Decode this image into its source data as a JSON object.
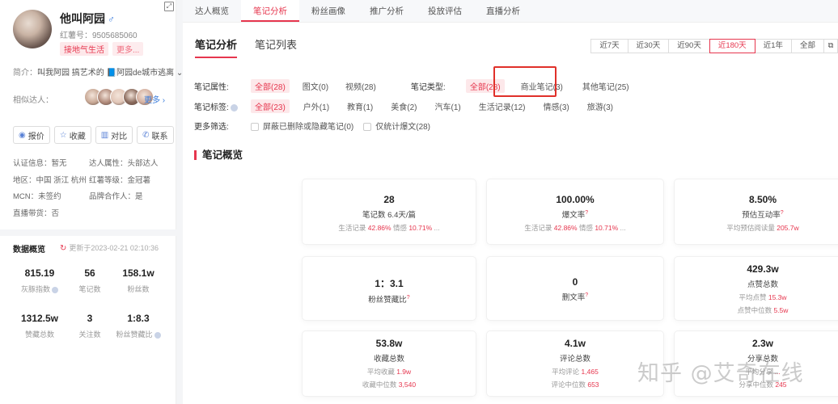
{
  "profile": {
    "name": "他叫阿园",
    "gender_icon": "♂",
    "red_id": "红薯号：9505685060",
    "tags": [
      "接地气生活",
      "更多..."
    ],
    "intro_label": "简介：",
    "intro_text": "叫我阿园 搞艺术的 📘阿园de城市逃离",
    "similar_label": "相似达人：",
    "more_label": "更多",
    "similar_colors": [
      "#c9a996",
      "#b08a7a",
      "#e2c7b8",
      "#8a6a5c",
      "#d4b0a0"
    ]
  },
  "actions": [
    {
      "icon": "◉",
      "label": "报价"
    },
    {
      "icon": "☆",
      "label": "收藏"
    },
    {
      "icon": "▥",
      "label": "对比"
    },
    {
      "icon": "✆",
      "label": "联系"
    }
  ],
  "info": [
    [
      "认证信息：暂无",
      "达人属性：头部达人"
    ],
    [
      "地区：中国 浙江 杭州",
      "红薯等级：金冠薯"
    ],
    [
      "MCN：未签约",
      "品牌合作人：是"
    ],
    [
      "直播带货：否",
      ""
    ]
  ],
  "data_overview": {
    "title": "数据概览",
    "refresh_icon": "↻",
    "updated": "更新于2023-02-21 02:10:36",
    "stats": [
      {
        "value": "815.19",
        "label": "灰豚指数",
        "q": true
      },
      {
        "value": "56",
        "label": "笔记数",
        "q": false
      },
      {
        "value": "158.1w",
        "label": "粉丝数",
        "q": false
      },
      {
        "value": "1312.5w",
        "label": "赞藏总数",
        "q": false
      },
      {
        "value": "3",
        "label": "关注数",
        "q": false
      },
      {
        "value": "1:8.3",
        "label": "粉丝赞藏比",
        "q": true
      }
    ]
  },
  "topnav": [
    "达人概览",
    "笔记分析",
    "粉丝画像",
    "推广分析",
    "投放评估",
    "直播分析"
  ],
  "topnav_active": 1,
  "subtabs": [
    "笔记分析",
    "笔记列表"
  ],
  "ranges": [
    "近7天",
    "近30天",
    "近90天",
    "近180天",
    "近1年",
    "全部"
  ],
  "range_active": 3,
  "range_icon": "⧉",
  "filters": {
    "attr_label": "笔记属性:",
    "attr": [
      "全部(28)",
      "图文(0)",
      "视频(28)"
    ],
    "type_label": "笔记类型:",
    "type": [
      "全部(28)",
      "商业笔记(3)",
      "其他笔记(25)"
    ],
    "tag_label": "笔记标签:",
    "tags": [
      "全部(23)",
      "户外(1)",
      "教育(1)",
      "美食(2)",
      "汽车(1)",
      "生活记录(12)",
      "情感(3)",
      "旅游(3)"
    ],
    "more_label": "更多筛选:",
    "more": [
      "屏蔽已删除或隐藏笔记(0)",
      "仅统计爆文(28)"
    ]
  },
  "section_title": "笔记概览",
  "cards": [
    {
      "value": "28",
      "label": "笔记数",
      "label_extra": "6.4天/篇",
      "tip": false,
      "subs": [
        {
          "text": "生活记录 ",
          "num": "42.86%"
        },
        {
          "text": " 情感 ",
          "num": "10.71%"
        },
        {
          "text": " ...",
          "num": ""
        }
      ]
    },
    {
      "value": "100.00%",
      "label": "爆文率",
      "label_extra": "",
      "tip": true,
      "subs": [
        {
          "text": "生活记录 ",
          "num": "42.86%"
        },
        {
          "text": " 情感 ",
          "num": "10.71%"
        },
        {
          "text": " ...",
          "num": ""
        }
      ]
    },
    {
      "value": "8.50%",
      "label": "预估互动率",
      "label_extra": "",
      "tip": true,
      "subs": [
        {
          "text": "平均预估阅读量 ",
          "num": "205.7w"
        }
      ]
    },
    {
      "value": "1：3.1",
      "label": "粉丝赞藏比",
      "label_extra": "",
      "tip": true,
      "subs": []
    },
    {
      "value": "0",
      "label": "删文率",
      "label_extra": "",
      "tip": true,
      "subs": []
    },
    {
      "value": "429.3w",
      "label": "点赞总数",
      "label_extra": "",
      "tip": false,
      "subs": [
        {
          "text": "平均点赞 ",
          "num": "15.3w"
        },
        {
          "text": "点赞中位数 ",
          "num": "5.5w"
        }
      ]
    },
    {
      "value": "53.8w",
      "label": "收藏总数",
      "label_extra": "",
      "tip": false,
      "subs": [
        {
          "text": "平均收藏 ",
          "num": "1.9w"
        },
        {
          "text": "收藏中位数 ",
          "num": "3,540"
        }
      ]
    },
    {
      "value": "4.1w",
      "label": "评论总数",
      "label_extra": "",
      "tip": false,
      "subs": [
        {
          "text": "平均评论 ",
          "num": "1,465"
        },
        {
          "text": "评论中位数 ",
          "num": "653"
        }
      ]
    },
    {
      "value": "2.3w",
      "label": "分享总数",
      "label_extra": "",
      "tip": false,
      "subs": [
        {
          "text": "平均分享 ",
          "num": "..."
        },
        {
          "text": "分享中位数 ",
          "num": "245"
        }
      ]
    }
  ],
  "tip_glyph": "?",
  "watermark": "知乎 @艾奇在线"
}
